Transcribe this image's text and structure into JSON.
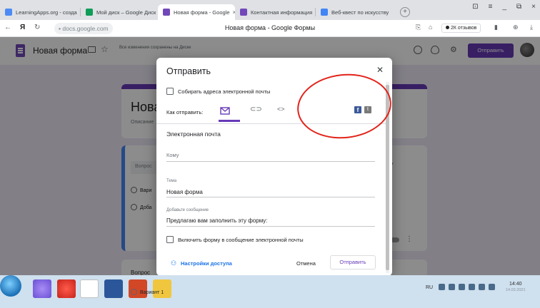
{
  "browser": {
    "tabs": [
      {
        "label": "LearningApps.org - созда",
        "color": "#4c8bf5"
      },
      {
        "label": "Мой диск – Google Диск",
        "color": "#0f9d58"
      },
      {
        "label": "Новая форма - Google",
        "color": "#7248b9",
        "active": true
      },
      {
        "label": "Контактная информация",
        "color": "#7248b9"
      },
      {
        "label": "Веб-квест по искусству",
        "color": "#4285f4"
      }
    ],
    "close_glyph": "×",
    "newtab_glyph": "+",
    "url": "docs.google.com",
    "page_title": "Новая форма - Google Формы",
    "reviews": "2К отзывов"
  },
  "form_header": {
    "title": "Новая форма",
    "save_status": "Все изменения сохранены на Диске",
    "send_label": "Отправить"
  },
  "form_bg": {
    "title": "Нова",
    "description": "Описание",
    "question": "Вопрос",
    "option1": "Вари",
    "option2": "Доба",
    "question2": "Вопрос",
    "option3": "Вариант 1"
  },
  "dialog": {
    "title": "Отправить",
    "collect_emails": "Собирать адреса электронной почты",
    "send_via": "Как отправить:",
    "embed_glyph": "<>",
    "section": "Электронная почта",
    "to_placeholder": "Кому",
    "subject_label": "Тема",
    "subject_value": "Новая форма",
    "message_label": "Добавьте сообщение",
    "message_value": "Предлагаю вам заполнить эту форму:",
    "include_form": "Включить форму в сообщение электронной почты",
    "access_settings": "Настройки доступа",
    "cancel": "Отмена",
    "send": "Отправить"
  },
  "taskbar": {
    "lang": "RU",
    "time": "14:40",
    "date": "14.02.2021"
  },
  "colors": {
    "accent": "#673ab7",
    "link": "#1a73e8",
    "annotation": "#e2231a"
  }
}
